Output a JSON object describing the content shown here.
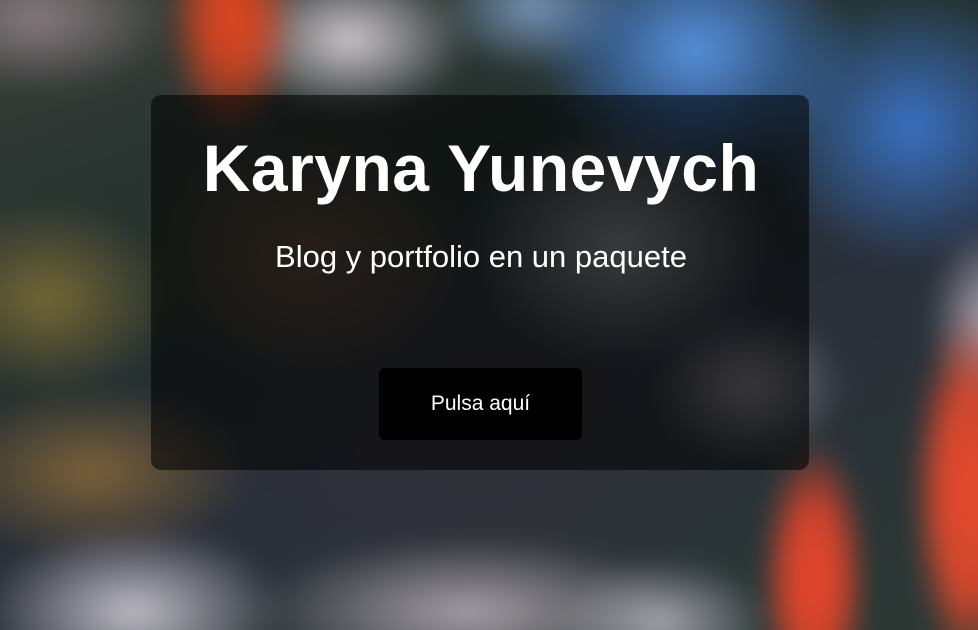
{
  "hero": {
    "title": "Karyna Yunevych",
    "subtitle": "Blog y portfolio en un paquete",
    "button_label": "Pulsa aquí"
  },
  "colors": {
    "overlay": "#000000",
    "text": "#ffffff",
    "button_bg": "#000000",
    "button_text": "#ffffff"
  }
}
